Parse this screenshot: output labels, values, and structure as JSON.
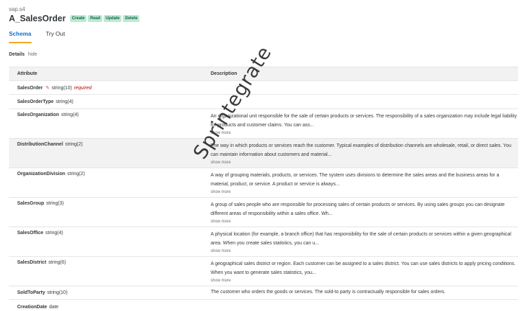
{
  "header": {
    "namespace": "sap.s4",
    "title": "A_SalesOrder",
    "badges": [
      "Create",
      "Read",
      "Update",
      "Delete"
    ]
  },
  "tabs": [
    {
      "label": "Schema",
      "active": true
    },
    {
      "label": "Try Out",
      "active": false
    }
  ],
  "details": {
    "label": "Details",
    "toggle": "hide"
  },
  "table": {
    "headers": {
      "attribute": "Attribute",
      "description": "Description"
    },
    "show_more": "show more",
    "rows": [
      {
        "name": "SalesOrder",
        "type": "string(10)",
        "required": "required",
        "description": ""
      },
      {
        "name": "SalesOrderType",
        "type": "string(4)",
        "description": ""
      },
      {
        "name": "SalesOrganization",
        "type": "string(4)",
        "description": "An organizational unit responsible for the sale of certain products or services. The responsibility of a sales organization may include legal liability for products and customer claims. You can ass..."
      },
      {
        "name": "DistributionChannel",
        "type": "string(2)",
        "description": "The way in which products or services reach the customer. Typical examples of distribution channels are wholesale, retail, or direct sales. You can maintain information about customers and material..."
      },
      {
        "name": "OrganizationDivision",
        "type": "string(2)",
        "description": "A way of grouping materials, products, or services. The system uses divisions to determine the sales areas and the business areas for a material, product, or service. A product or service is always..."
      },
      {
        "name": "SalesGroup",
        "type": "string(3)",
        "description": "A group of sales people who are responsible for processing sales of certain products or services. By using sales groups you can designate different areas of responsibility within a sales office. Wh..."
      },
      {
        "name": "SalesOffice",
        "type": "string(4)",
        "description": "A physical location (for example, a branch office) that has responsibility for the sale of certain products or services within a given geographical area. When you create sales statistics, you can u..."
      },
      {
        "name": "SalesDistrict",
        "type": "string(6)",
        "description": "A geographical sales district or region. Each customer can be assigned to a sales district. You can use sales districts to apply pricing conditions. When you want to generate sales statistics, you..."
      },
      {
        "name": "SoldToParty",
        "type": "string(10)",
        "description": "The customer who orders the goods or services. The sold-to party is contractually responsible for sales orders."
      },
      {
        "name": "CreationDate",
        "type": "date",
        "description": ""
      }
    ]
  },
  "watermark": "Sprintegrate",
  "colors": {
    "accent": "#0a6ed1",
    "tab_underline": "#f5a623",
    "badge_bg": "#bfe8d3",
    "required": "#bb0000"
  },
  "icons": {
    "edit": "pencil-icon"
  }
}
